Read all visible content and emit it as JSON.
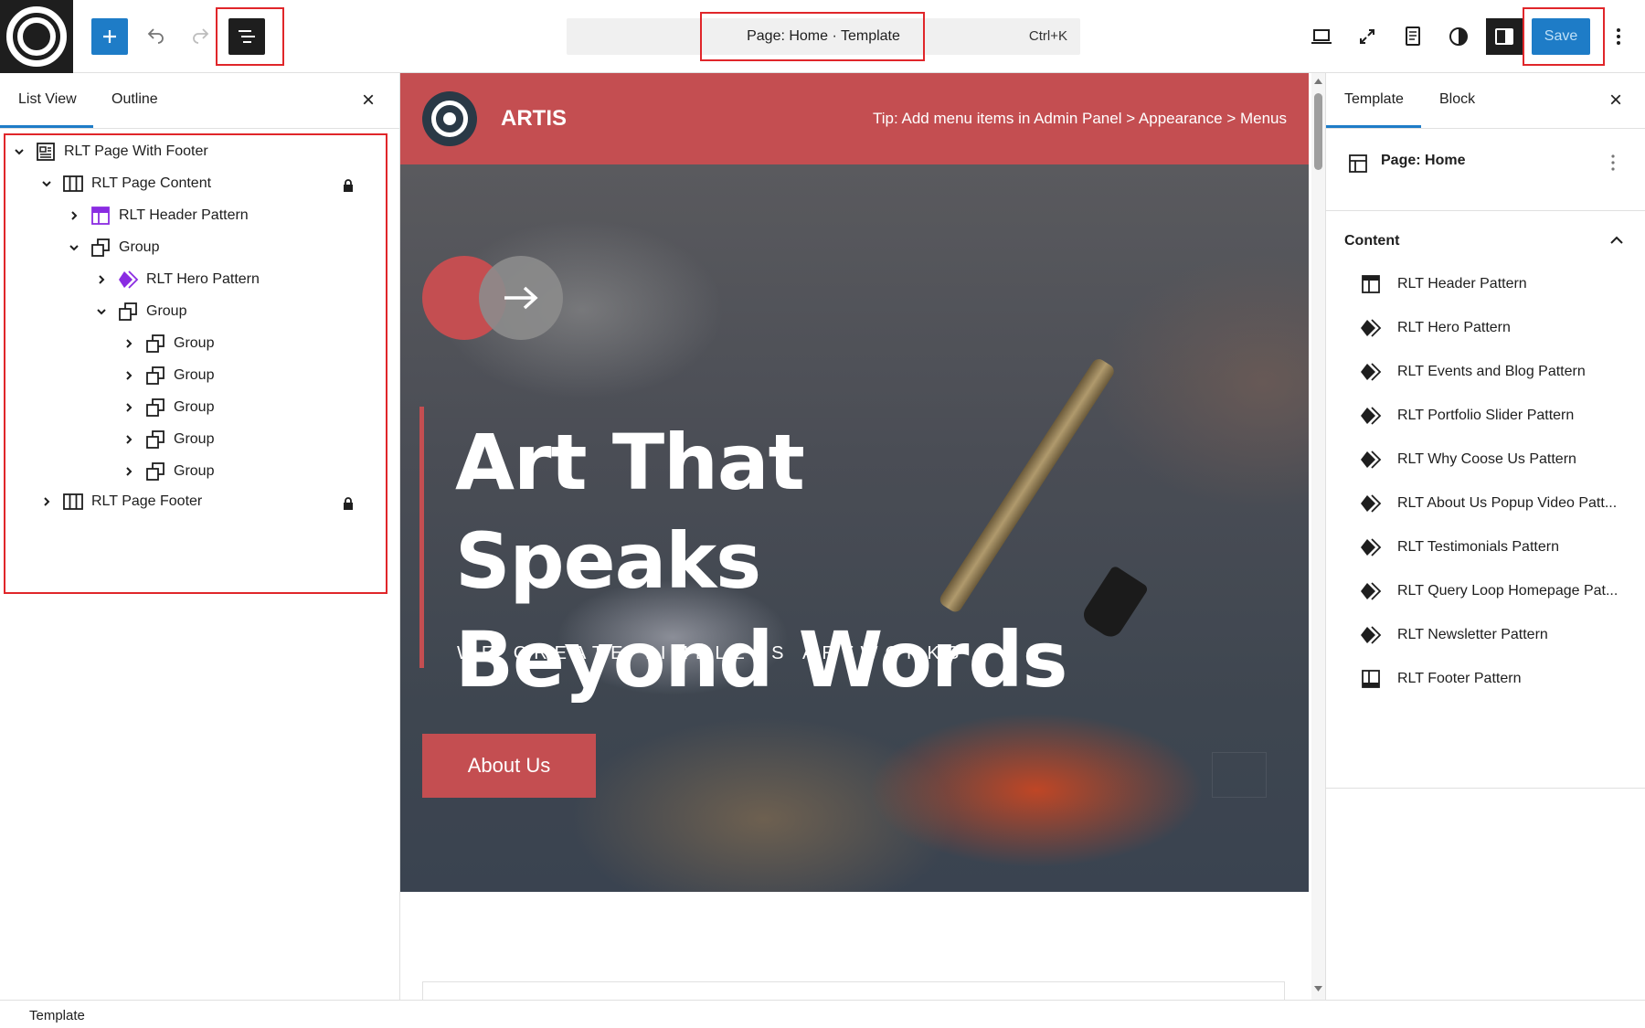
{
  "topbar": {
    "command_title": "Page: Home · Template",
    "command_shortcut": "Ctrl+K",
    "save_label": "Save"
  },
  "left_panel": {
    "tabs": [
      "List View",
      "Outline"
    ],
    "tree": [
      {
        "label": "RLT Page With Footer",
        "icon": "page-icon"
      },
      {
        "label": "RLT Page Content",
        "icon": "columns-icon",
        "locked": true
      },
      {
        "label": "RLT Header Pattern",
        "icon": "template-part-icon"
      },
      {
        "label": "Group",
        "icon": "group-icon"
      },
      {
        "label": "RLT Hero Pattern",
        "icon": "pattern-diamond-icon"
      },
      {
        "label": "Group",
        "icon": "group-icon"
      },
      {
        "label": "Group",
        "icon": "group-icon"
      },
      {
        "label": "Group",
        "icon": "group-icon"
      },
      {
        "label": "Group",
        "icon": "group-icon"
      },
      {
        "label": "Group",
        "icon": "group-icon"
      },
      {
        "label": "Group",
        "icon": "group-icon"
      },
      {
        "label": "RLT Page Footer",
        "icon": "columns-icon",
        "locked": true
      }
    ]
  },
  "site": {
    "name": "ARTIS",
    "tip": "Tip: Add menu items in Admin Panel > Appearance > Menus",
    "hero_title_line1": "Art That Speaks",
    "hero_title_line2": "Beyond Words",
    "hero_subtitle": "WE CREATE TIMELESS ARTWORKS",
    "cta_label": "About Us",
    "brand_color": "#c44e51"
  },
  "right_panel": {
    "tabs": [
      "Template",
      "Block"
    ],
    "page_title": "Page: Home",
    "section_title": "Content",
    "items": [
      "RLT Header Pattern",
      "RLT Hero Pattern",
      "RLT Events and Blog Pattern",
      "RLT Portfolio Slider Pattern",
      "RLT Why Coose Us Pattern",
      "RLT About Us Popup Video Patt...",
      "RLT Testimonials Pattern",
      "RLT Query Loop Homepage Pat...",
      "RLT Newsletter Pattern",
      "RLT Footer Pattern"
    ]
  },
  "statusbar": {
    "breadcrumb": "Template"
  }
}
